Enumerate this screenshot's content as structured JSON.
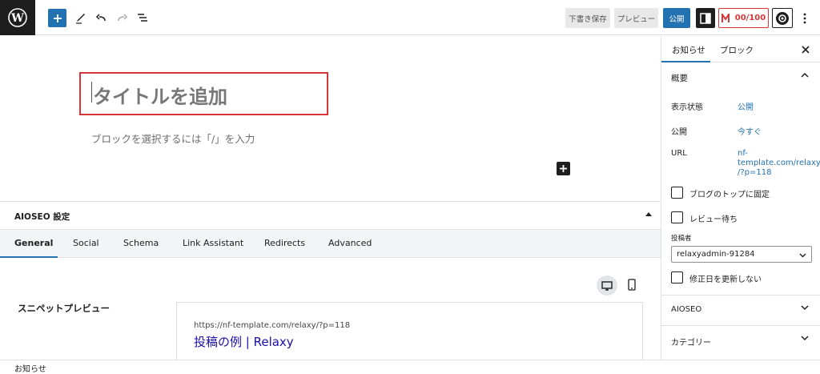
{
  "topbar": {
    "save_draft": "下書き保存",
    "preview": "プレビュー",
    "publish": "公開",
    "aioseo_score": "00/100"
  },
  "editor": {
    "title_placeholder": "タイトルを追加",
    "block_placeholder": "ブロックを選択するには「/」を入力"
  },
  "aioseo": {
    "panel_title": "AIOSEO 設定",
    "tabs": [
      "General",
      "Social",
      "Schema",
      "Link Assistant",
      "Redirects",
      "Advanced"
    ],
    "active_tab": "General",
    "snippet_label": "スニペットプレビュー",
    "snippet_url": "https://nf-template.com/relaxy/?p=118",
    "snippet_title": "投稿の例 | Relaxy"
  },
  "footer": {
    "breadcrumb": "お知らせ"
  },
  "sidebar": {
    "tabs": [
      "お知らせ",
      "ブロック"
    ],
    "summary_title": "概要",
    "visibility_label": "表示状態",
    "visibility_value": "公開",
    "publish_label": "公開",
    "publish_value": "今すぐ",
    "url_label": "URL",
    "url_line1": "nf-",
    "url_line2": "template.com/relaxy",
    "url_line3": "/?p=118",
    "sticky_label": "ブログのトップに固定",
    "pending_label": "レビュー待ち",
    "author_label": "投稿者",
    "author_value": "relaxyadmin-91284",
    "no_modified_label": "修正日を更新しない",
    "sections": [
      "AIOSEO",
      "カテゴリー"
    ]
  },
  "colors": {
    "accent": "#2271b1",
    "score_red": "#d63638",
    "dark": "#1e1e1e"
  }
}
